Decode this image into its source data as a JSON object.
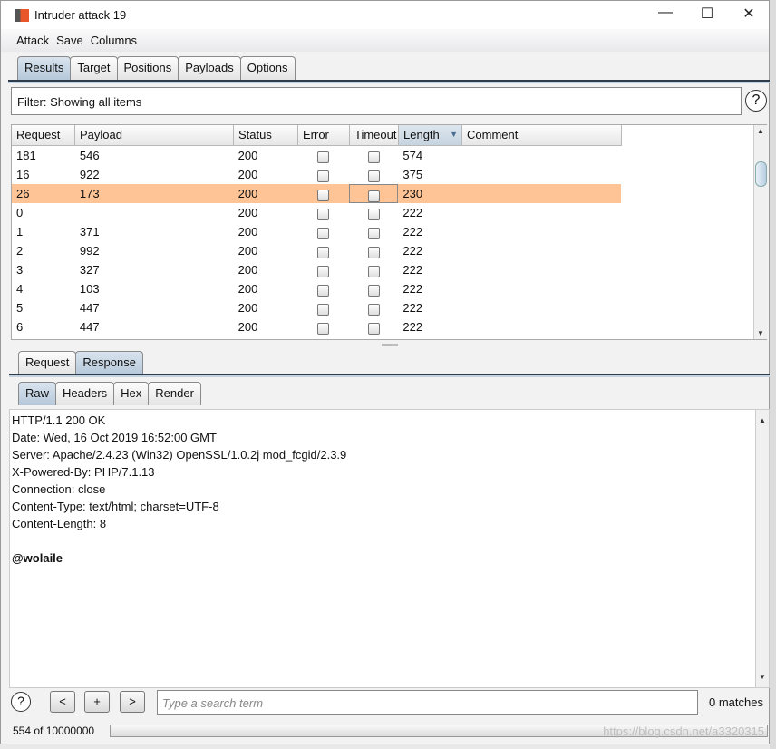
{
  "window": {
    "title": "Intruder attack 19"
  },
  "menu": [
    "Attack",
    "Save",
    "Columns"
  ],
  "tabs": [
    "Results",
    "Target",
    "Positions",
    "Payloads",
    "Options"
  ],
  "filter": "Filter: Showing all items",
  "table": {
    "columns": [
      "Request",
      "Payload",
      "Status",
      "Error",
      "Timeout",
      "Length",
      "Comment"
    ],
    "sorted_column": "Length",
    "rows": [
      {
        "request": "181",
        "payload": "546",
        "status": "200",
        "length": "574",
        "selected": false
      },
      {
        "request": "16",
        "payload": "922",
        "status": "200",
        "length": "375",
        "selected": false
      },
      {
        "request": "26",
        "payload": "173",
        "status": "200",
        "length": "230",
        "selected": true
      },
      {
        "request": "0",
        "payload": "",
        "status": "200",
        "length": "222",
        "selected": false
      },
      {
        "request": "1",
        "payload": "371",
        "status": "200",
        "length": "222",
        "selected": false
      },
      {
        "request": "2",
        "payload": "992",
        "status": "200",
        "length": "222",
        "selected": false
      },
      {
        "request": "3",
        "payload": "327",
        "status": "200",
        "length": "222",
        "selected": false
      },
      {
        "request": "4",
        "payload": "103",
        "status": "200",
        "length": "222",
        "selected": false
      },
      {
        "request": "5",
        "payload": "447",
        "status": "200",
        "length": "222",
        "selected": false
      },
      {
        "request": "6",
        "payload": "447",
        "status": "200",
        "length": "222",
        "selected": false
      }
    ]
  },
  "msg_tabs": [
    "Request",
    "Response"
  ],
  "view_tabs": [
    "Raw",
    "Headers",
    "Hex",
    "Render"
  ],
  "response_lines": [
    "HTTP/1.1 200 OK",
    "Date: Wed, 16 Oct 2019 16:52:00 GMT",
    "Server: Apache/2.4.23 (Win32) OpenSSL/1.0.2j mod_fcgid/2.3.9",
    "X-Powered-By: PHP/7.1.13",
    "Connection: close",
    "Content-Type: text/html; charset=UTF-8",
    "Content-Length: 8",
    "",
    "@wolaile"
  ],
  "search": {
    "placeholder": "Type a search term",
    "matches": "0 matches",
    "prev": "<",
    "add": "+",
    "next": ">"
  },
  "status": {
    "progress_text": "554 of 10000000",
    "progress_fraction": 5.54e-05
  },
  "watermark": "https://blog.csdn.net/a3320315",
  "colors": {
    "selected_row": "#ffc495",
    "active_tab": "#b5c8da"
  }
}
